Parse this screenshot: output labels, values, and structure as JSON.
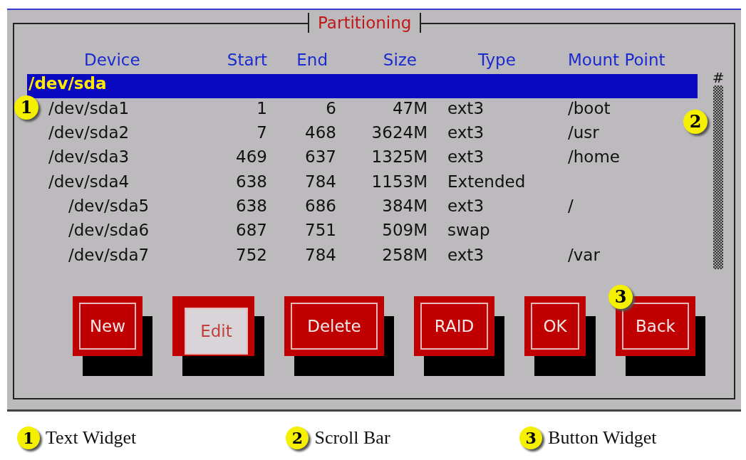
{
  "dialog": {
    "title": "Partitioning"
  },
  "table": {
    "columns": [
      "Device",
      "Start",
      "End",
      "Size",
      "Type",
      "Mount Point"
    ],
    "rows": [
      {
        "device": "/dev/sda",
        "selected": true,
        "children": [
          {
            "device": "/dev/sda1",
            "start": "1",
            "end": "6",
            "size": "47M",
            "type": "ext3",
            "mount": "/boot",
            "selected": false,
            "callout": "1"
          },
          {
            "device": "/dev/sda2",
            "start": "7",
            "end": "468",
            "size": "3624M",
            "type": "ext3",
            "mount": "/usr",
            "selected": false
          },
          {
            "device": "/dev/sda3",
            "start": "469",
            "end": "637",
            "size": "1325M",
            "type": "ext3",
            "mount": "/home",
            "selected": false
          },
          {
            "device": "/dev/sda4",
            "start": "638",
            "end": "784",
            "size": "1153M",
            "type": "Extended",
            "selected": false,
            "children": [
              {
                "device": "/dev/sda5",
                "start": "638",
                "end": "686",
                "size": "384M",
                "type": "ext3",
                "mount": "/",
                "selected": false
              },
              {
                "device": "/dev/sda6",
                "start": "687",
                "end": "751",
                "size": "509M",
                "type": "swap",
                "selected": false
              },
              {
                "device": "/dev/sda7",
                "start": "752",
                "end": "784",
                "size": "258M",
                "type": "ext3",
                "mount": "/var",
                "selected": false
              }
            ]
          }
        ]
      }
    ]
  },
  "scrollbar": {
    "thumb": "#",
    "callout": "2"
  },
  "buttons": [
    {
      "label": "New",
      "focused": false
    },
    {
      "label": "Edit",
      "focused": true
    },
    {
      "label": "Delete",
      "focused": false
    },
    {
      "label": "RAID",
      "focused": false
    },
    {
      "label": "OK",
      "focused": false
    },
    {
      "label": "Back",
      "focused": false,
      "callout": "3"
    }
  ],
  "legend": [
    {
      "number": "1",
      "label": "Text Widget"
    },
    {
      "number": "2",
      "label": "Scroll Bar"
    },
    {
      "number": "3",
      "label": "Button Widget"
    }
  ]
}
